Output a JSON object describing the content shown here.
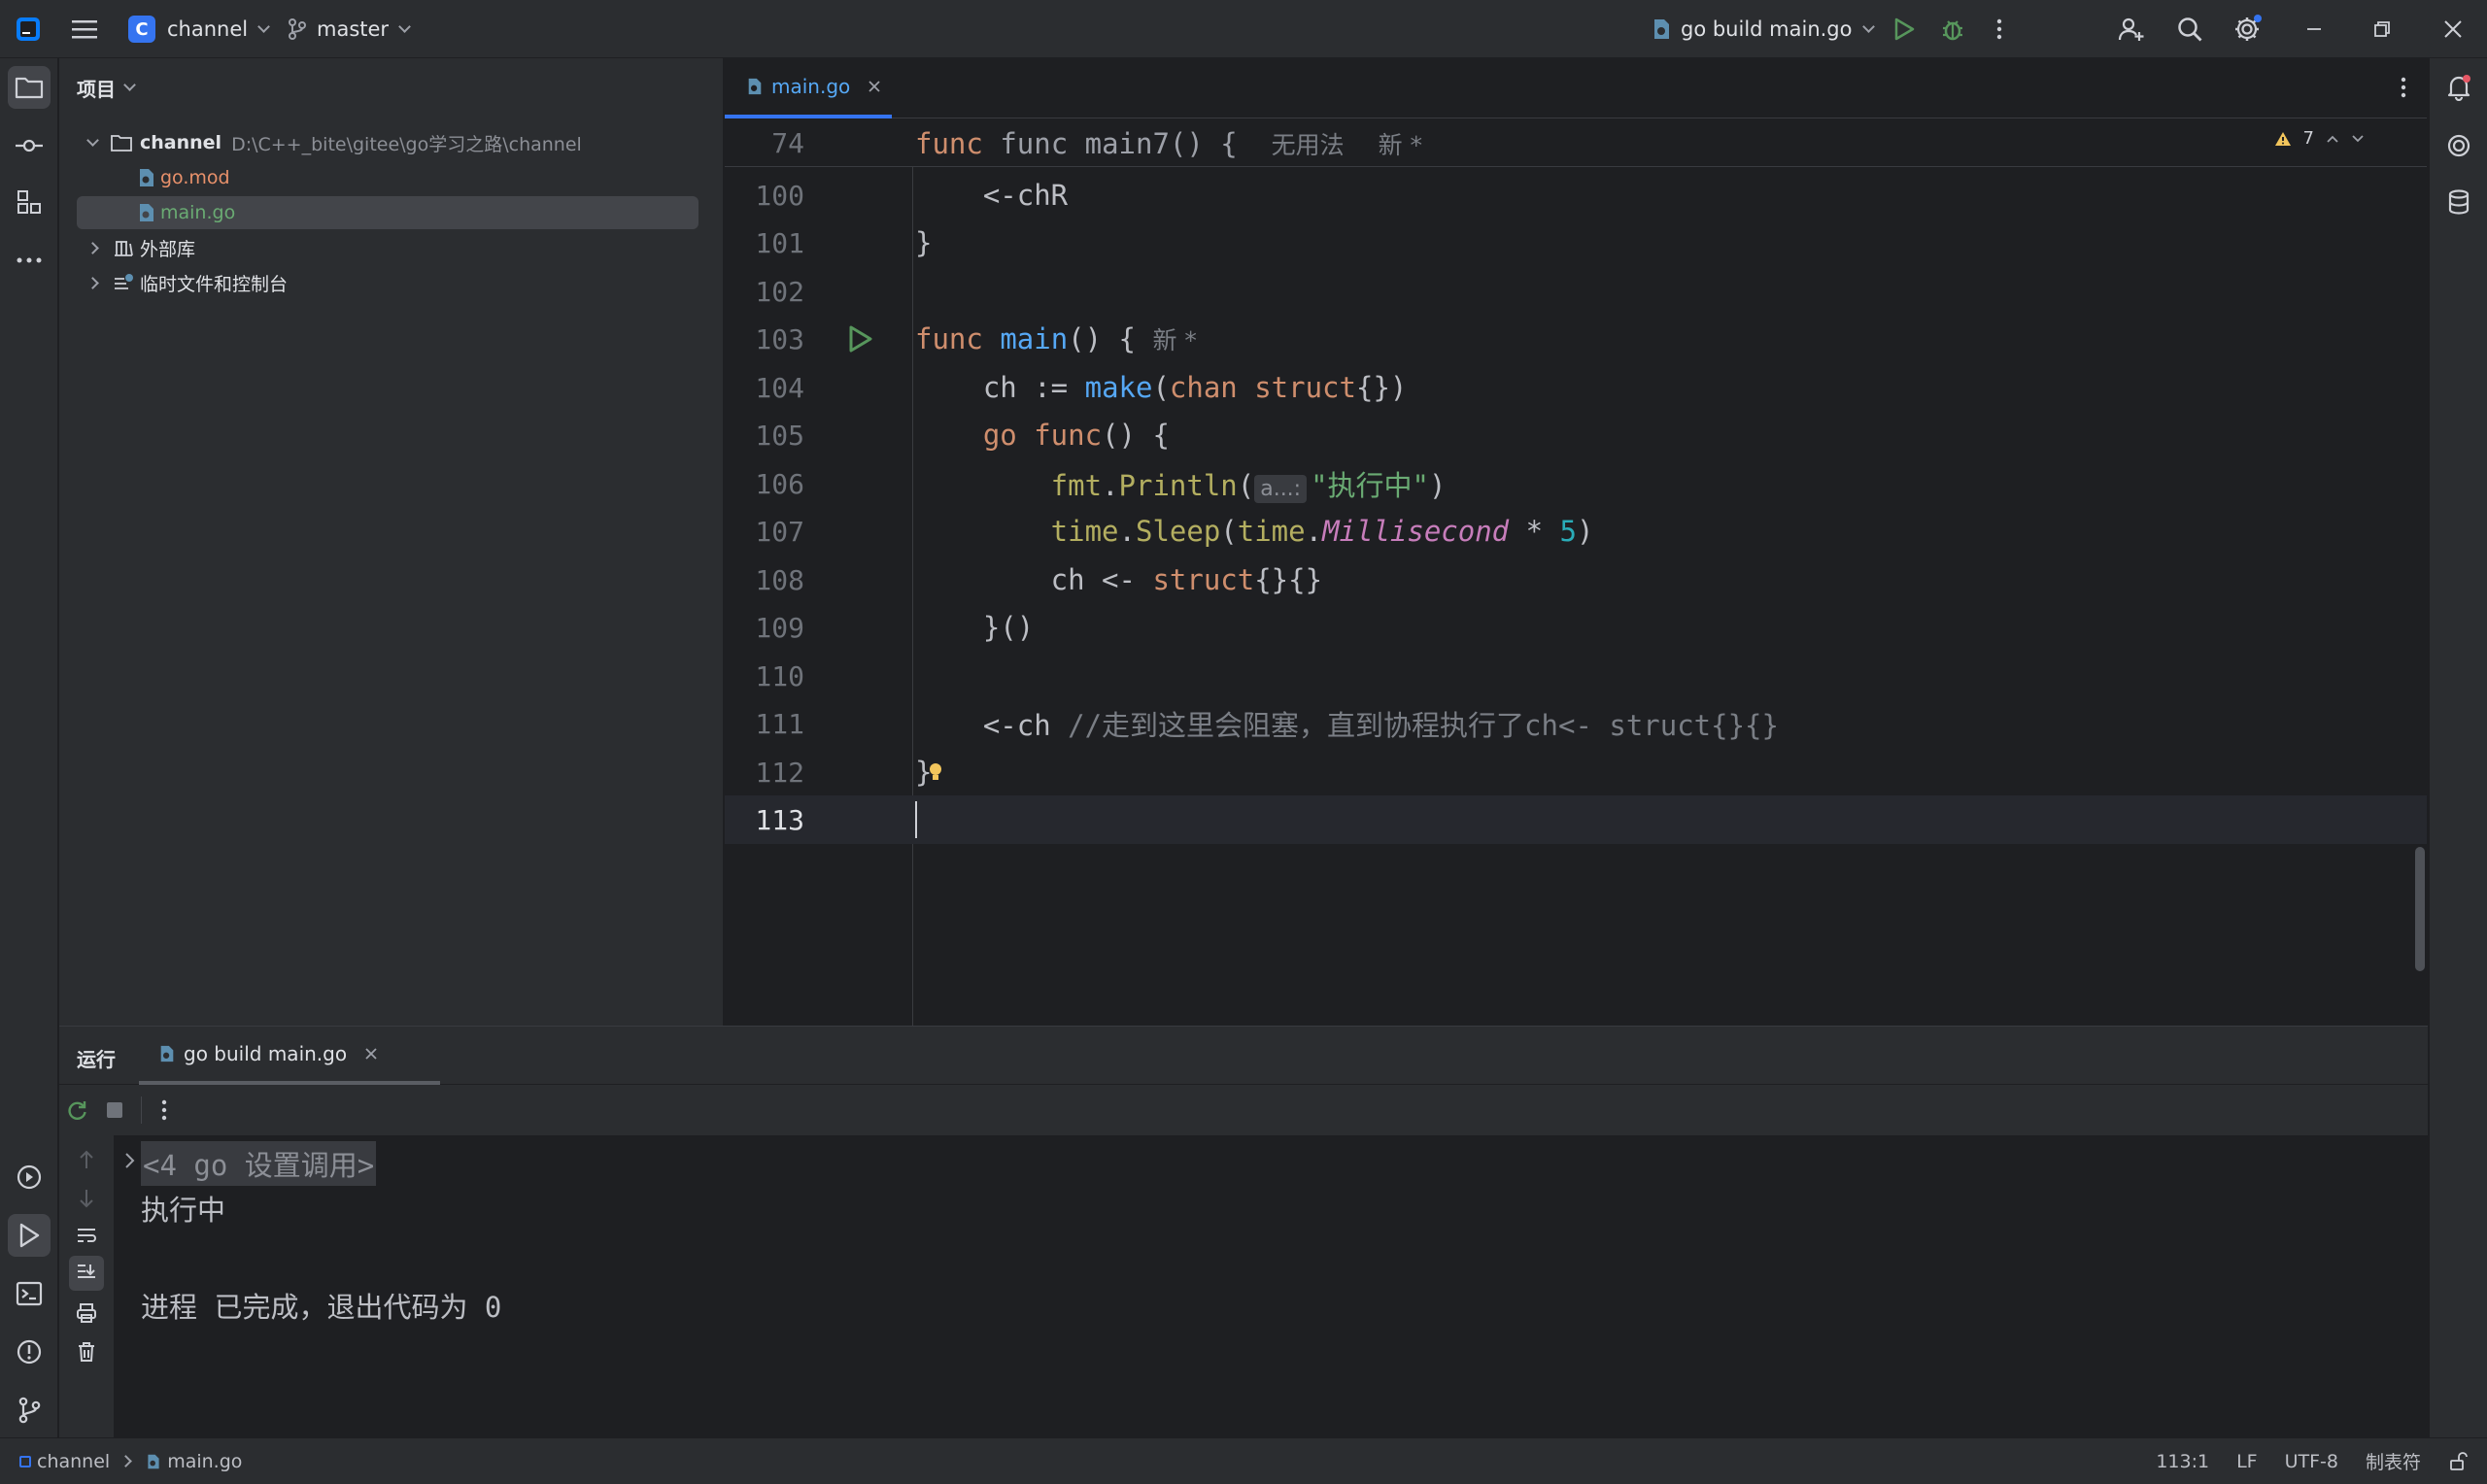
{
  "topbar": {
    "project_initial": "C",
    "project_name": "channel",
    "branch": "master",
    "run_config": "go build main.go"
  },
  "project_panel": {
    "title": "项目",
    "tree": [
      {
        "name": "channel",
        "path": "D:\\C++_bite\\gitee\\go学习之路\\channel",
        "expanded": true
      },
      {
        "name": "go.mod"
      },
      {
        "name": "main.go",
        "selected": true
      },
      {
        "name": "外部库",
        "expanded": false
      },
      {
        "name": "临时文件和控制台",
        "expanded": false
      }
    ]
  },
  "editor": {
    "tab": "main.go",
    "warnings": "7",
    "sticky": {
      "line": "74",
      "code": "func main7() {",
      "hint1": "无用法",
      "hint2": "新 *"
    },
    "lines": [
      {
        "n": "100"
      },
      {
        "n": "101"
      },
      {
        "n": "102"
      },
      {
        "n": "103"
      },
      {
        "n": "104"
      },
      {
        "n": "105"
      },
      {
        "n": "106"
      },
      {
        "n": "107"
      },
      {
        "n": "108"
      },
      {
        "n": "109"
      },
      {
        "n": "110"
      },
      {
        "n": "111"
      },
      {
        "n": "112"
      },
      {
        "n": "113"
      }
    ],
    "code": {
      "l100": "    <-chR",
      "l101": "}",
      "l103_kw": "func ",
      "l103_fn": "main",
      "l103_rest": "() { ",
      "l103_hint": "新 *",
      "l104_a": "    ch := ",
      "l104_make": "make",
      "l104_b": "(",
      "l104_chan": "chan struct",
      "l104_c": "{})",
      "l105_a": "    ",
      "l105_go": "go func",
      "l105_b": "() {",
      "l106_pkg": "        fmt",
      "l106_dot": ".",
      "l106_fn": "Println",
      "l106_paren": "(",
      "l106_inlay": "a...:",
      "l106_str": "\"执行中\"",
      "l106_close": ")",
      "l107_pkg": "        time",
      "l107_dot": ".",
      "l107_fn": "Sleep",
      "l107_p1": "(",
      "l107_pkg2": "time",
      "l107_dot2": ".",
      "l107_const": "Millisecond",
      "l107_op": " * ",
      "l107_num": "5",
      "l107_p2": ")",
      "l108_a": "        ch <- ",
      "l108_struct": "struct",
      "l108_b": "{}{}",
      "l109": "    }()",
      "l111_a": "    <-ch ",
      "l111_cmt": "//走到这里会阻塞，直到协程执行了ch<- struct{}{}",
      "l112": "}"
    }
  },
  "run_panel": {
    "label": "运行",
    "tab": "go build main.go",
    "output": {
      "collapsed": "<4 go 设置调用>",
      "line1": "执行中",
      "line2": "进程 已完成，退出代码为 0"
    }
  },
  "statusbar": {
    "crumb1": "channel",
    "crumb2": "main.go",
    "position": "113:1",
    "line_ending": "LF",
    "encoding": "UTF-8",
    "indent": "制表符"
  }
}
